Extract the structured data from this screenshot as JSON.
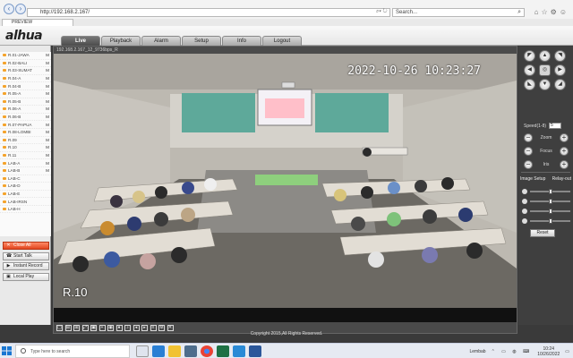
{
  "browser": {
    "url": "http://192.168.2.167/",
    "search_placeholder": "Search...",
    "tab_title": "PREVIEW"
  },
  "app": {
    "brand": "alhua",
    "menu": [
      "Live",
      "Playback",
      "Alarm",
      "Setup",
      "Info",
      "Logout"
    ],
    "active_menu": "Live",
    "video_header": "192.168.2.167_12_9736bps_R",
    "osd_time": "2022-10-26  10:23:27",
    "osd_name": "R.10",
    "copyright": "Copyright 2015,All Rights Reserved.",
    "cameras": [
      {
        "label": "R.01-JAWA",
        "mode": "M"
      },
      {
        "label": "R.02-BALI",
        "mode": "M"
      },
      {
        "label": "R.03-SUMAT",
        "mode": "M"
      },
      {
        "label": "R.04-A",
        "mode": "M"
      },
      {
        "label": "R.04-B",
        "mode": "M"
      },
      {
        "label": "R.05-A",
        "mode": "M"
      },
      {
        "label": "R.05-B",
        "mode": "M"
      },
      {
        "label": "R.06-A",
        "mode": "M"
      },
      {
        "label": "R.06-B",
        "mode": "M"
      },
      {
        "label": "R.07-PAPUA",
        "mode": "M"
      },
      {
        "label": "R.08-LOMBI",
        "mode": "M"
      },
      {
        "label": "R.09",
        "mode": "M"
      },
      {
        "label": "R.10",
        "mode": "M"
      },
      {
        "label": "R.11",
        "mode": "M"
      },
      {
        "label": "LAB-A",
        "mode": "M"
      },
      {
        "label": "LAB-B",
        "mode": "M"
      },
      {
        "label": "LAB-C",
        "mode": ""
      },
      {
        "label": "LAB-D",
        "mode": ""
      },
      {
        "label": "LAB-E",
        "mode": ""
      },
      {
        "label": "LAB-IRSN",
        "mode": ""
      },
      {
        "label": "LAB-H",
        "mode": ""
      }
    ],
    "left_buttons": {
      "close_all": "Close All",
      "start_talk": "Start Talk",
      "instant_record": "Instant Record",
      "local_play": "Local Play"
    },
    "ptz": {
      "speed_label": "Speed(1-8)",
      "speed_value": "5",
      "zoom": "Zoom",
      "focus": "Focus",
      "iris": "Iris"
    },
    "image_setup": {
      "tab1": "Image Setup",
      "tab2": "Relay-out",
      "reset": "Reset",
      "levels": [
        0.5,
        0.5,
        0.5,
        0.5
      ]
    }
  },
  "taskbar": {
    "search_placeholder": "Type here to search",
    "user": "Lembab",
    "time": "10:24",
    "date": "10/26/2022"
  },
  "colors": {
    "brand_red": "#e0241b",
    "active_btn": "#e1451f"
  }
}
